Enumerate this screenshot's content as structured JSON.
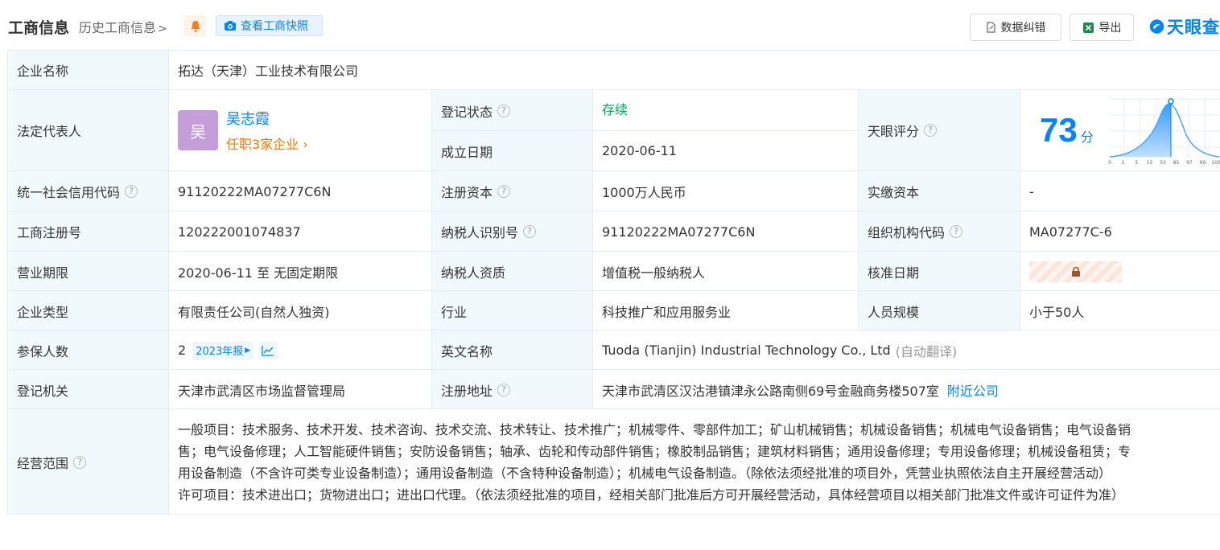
{
  "header": {
    "title": "工商信息",
    "history_label": "历史工商信息",
    "snapshot_label": "查看工商快照",
    "correction_label": "数据纠错",
    "export_label": "导出",
    "logo_text": "天眼查"
  },
  "company": {
    "name_label": "企业名称",
    "name_value": "拓达（天津）工业技术有限公司"
  },
  "legal_rep": {
    "label": "法定代表人",
    "avatar_char": "吴",
    "name": "吴志霞",
    "roles": "任职3家企业"
  },
  "reg_status": {
    "label": "登记状态",
    "value": "存续"
  },
  "found_date": {
    "label": "成立日期",
    "value": "2020-06-11"
  },
  "score": {
    "label": "天眼评分",
    "value": "73",
    "unit": "分",
    "axis_ticks": [
      "0",
      "1",
      "3",
      "15",
      "50",
      "85",
      "97",
      "99",
      "100"
    ]
  },
  "credit_code": {
    "label": "统一社会信用代码",
    "value": "91120222MA07277C6N"
  },
  "reg_capital": {
    "label": "注册资本",
    "value": "1000万人民币"
  },
  "paid_capital": {
    "label": "实缴资本",
    "value": "-"
  },
  "reg_no": {
    "label": "工商注册号",
    "value": "120222001074837"
  },
  "taxpayer_id": {
    "label": "纳税人识别号",
    "value": "91120222MA07277C6N"
  },
  "org_code": {
    "label": "组织机构代码",
    "value": "MA07277C-6"
  },
  "business_term": {
    "label": "营业期限",
    "value": "2020-06-11 至 无固定期限"
  },
  "taxpayer_qual": {
    "label": "纳税人资质",
    "value": "增值税一般纳税人"
  },
  "approval_date": {
    "label": "核准日期"
  },
  "company_type": {
    "label": "企业类型",
    "value": "有限责任公司(自然人独资)"
  },
  "industry": {
    "label": "行业",
    "value": "科技推广和应用服务业"
  },
  "staff_size": {
    "label": "人员规模",
    "value": "小于50人"
  },
  "insured": {
    "label": "参保人数",
    "value": "2",
    "report_label": "2023年报"
  },
  "english_name": {
    "label": "英文名称",
    "value": "Tuoda (Tianjin) Industrial Technology Co., Ltd",
    "translate_note": "(自动翻译)"
  },
  "reg_authority": {
    "label": "登记机关",
    "value": "天津市武清区市场监督管理局"
  },
  "reg_address": {
    "label": "注册地址",
    "value": "天津市武清区汉沽港镇津永公路南侧69号金融商务楼507室",
    "nearby_label": "附近公司"
  },
  "scope": {
    "label": "经营范围",
    "lines": [
      "一般项目：技术服务、技术开发、技术咨询、技术交流、技术转让、技术推广；机械零件、零部件加工；矿山机械销售；机械设备销售；机械电气设备销售；电气设备销",
      "售；电气设备修理；人工智能硬件销售；安防设备销售；轴承、齿轮和传动部件销售；橡胶制品销售；建筑材料销售；通用设备修理；专用设备修理；机械设备租赁；专",
      "用设备制造（不含许可类专业设备制造）；通用设备制造（不含特种设备制造）；机械电气设备制造。（除依法须经批准的项目外，凭营业执照依法自主开展经营活动）",
      "许可项目：技术进出口；货物进出口；进出口代理。（依法须经批准的项目，经相关部门批准后方可开展经营活动，具体经营项目以相关部门批准文件或许可证件为准）"
    ]
  },
  "colors": {
    "accent": "#0084ff",
    "status_green": "#00a65a",
    "roles_orange": "#ff7800",
    "label_bg": "#f2f9fc"
  }
}
